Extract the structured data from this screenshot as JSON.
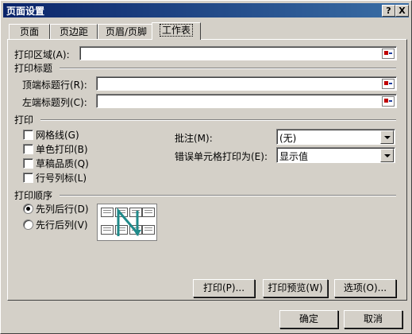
{
  "window": {
    "title": "页面设置",
    "help_btn": "?",
    "close_btn": "X"
  },
  "tabs": [
    {
      "label": "页面"
    },
    {
      "label": "页边距"
    },
    {
      "label": "页眉/页脚"
    },
    {
      "label": "工作表",
      "active": true
    }
  ],
  "print_area": {
    "label": "打印区域(A):",
    "value": ""
  },
  "print_titles": {
    "group": "打印标题",
    "rows_label": "顶端标题行(R):",
    "rows_value": "",
    "cols_label": "左端标题列(C):",
    "cols_value": ""
  },
  "print": {
    "group": "打印",
    "gridlines": "网格线(G)",
    "black_white": "单色打印(B)",
    "draft": "草稿品质(Q)",
    "row_col_headers": "行号列标(L)",
    "comments_label": "批注(M):",
    "comments_value": "(无)",
    "errors_label": "错误单元格打印为(E):",
    "errors_value": "显示值"
  },
  "page_order": {
    "group": "打印顺序",
    "down_then_over": "先列后行(D)",
    "over_then_down": "先行后列(V)",
    "selected": "down_then_over"
  },
  "buttons": {
    "print": "打印(P)...",
    "preview": "打印预览(W)",
    "options": "选项(O)...",
    "ok": "确定",
    "cancel": "取消"
  },
  "colors": {
    "title_start": "#0a246a",
    "title_end": "#3a6ea5",
    "arrow": "#1f8a8a"
  }
}
